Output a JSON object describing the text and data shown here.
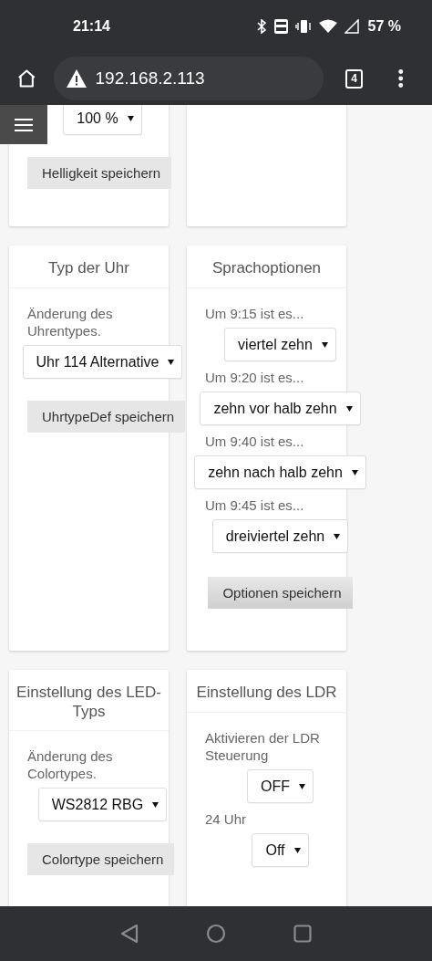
{
  "status_bar": {
    "time": "21:14",
    "battery": "57 %"
  },
  "browser": {
    "url": "192.168.2.113",
    "tab_count": "4"
  },
  "card_rows": [
    {
      "cards": [
        {
          "kind": "panel",
          "items": [
            {
              "kind": "select",
              "value": "100 %"
            },
            {
              "kind": "button",
              "label": "Helligkeit speichern"
            }
          ]
        },
        {
          "kind": "panel"
        }
      ]
    },
    {
      "cards": [
        {
          "kind": "panel",
          "title": "Typ der Uhr",
          "items": [
            {
              "kind": "label",
              "text": "Änderung des Uhrentypes."
            },
            {
              "kind": "select",
              "value": "Uhr 114 Alternative"
            },
            {
              "kind": "button",
              "label": "UhrtypeDef speichern"
            }
          ]
        },
        {
          "kind": "panel",
          "title": "Sprachoptionen",
          "items": [
            {
              "kind": "label",
              "text": "Um 9:15 ist es..."
            },
            {
              "kind": "select",
              "value": "viertel zehn"
            },
            {
              "kind": "label",
              "text": "Um 9:20 ist es..."
            },
            {
              "kind": "select",
              "value": "zehn vor halb zehn"
            },
            {
              "kind": "label",
              "text": "Um 9:40 ist es..."
            },
            {
              "kind": "select",
              "value": "zehn nach halb zehn"
            },
            {
              "kind": "label",
              "text": "Um 9:45 ist es..."
            },
            {
              "kind": "select",
              "value": "dreiviertel zehn"
            },
            {
              "kind": "shaded-button",
              "label": "Optionen speichern"
            }
          ]
        }
      ]
    },
    {
      "cards": [
        {
          "kind": "panel",
          "title": "Einstellung des LED-Typs",
          "items": [
            {
              "kind": "label",
              "text": "Änderung des Colortypes."
            },
            {
              "kind": "select",
              "value": "WS2812 RBG"
            },
            {
              "kind": "button",
              "label": "Colortype speichern"
            }
          ]
        },
        {
          "kind": "panel",
          "title": "Einstellung des LDR",
          "items": [
            {
              "kind": "label",
              "text": "Aktivieren der LDR Steuerung"
            },
            {
              "kind": "select",
              "value": "OFF"
            },
            {
              "kind": "label",
              "text": "24 Uhr"
            },
            {
              "kind": "select",
              "value": "Off"
            }
          ]
        }
      ]
    }
  ]
}
